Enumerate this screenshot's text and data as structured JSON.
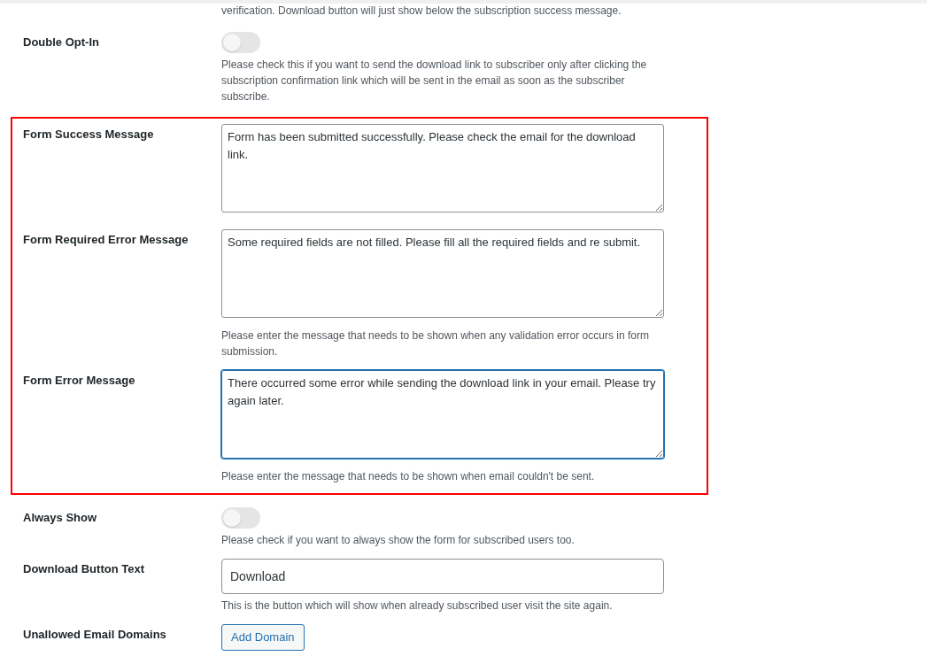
{
  "top_note": "verification. Download button will just show below the subscription success message.",
  "sections": [
    {
      "highlighted": false,
      "rows": [
        {
          "kind": "toggle",
          "label": "Double Opt-In",
          "on": false,
          "description": "Please check this if you want to send the download link to subscriber only after clicking the subscription confirmation link which will be sent in the email as soon as the subscriber subscribe."
        }
      ]
    },
    {
      "highlighted": true,
      "rows": [
        {
          "kind": "textarea",
          "label": "Form Success Message",
          "value": "Form has been submitted successfully. Please check the email for the download link.",
          "focused": false
        },
        {
          "kind": "textarea",
          "label": "Form Required Error Message",
          "value": "Some required fields are not filled. Please fill all the required fields and re submit.",
          "focused": false,
          "description": "Please enter the message that needs to be shown when any validation error occurs in form submission."
        },
        {
          "kind": "textarea",
          "label": "Form Error Message",
          "value": "There occurred some error while sending the download link in your email. Please try again later.",
          "focused": true,
          "description": "Please enter the message that needs to be shown when email couldn't be sent."
        }
      ]
    },
    {
      "highlighted": false,
      "rows": [
        {
          "kind": "toggle",
          "label": "Always Show",
          "on": false,
          "description": "Please check if you want to always show the form for subscribed users too."
        },
        {
          "kind": "input",
          "label": "Download Button Text",
          "value": "Download",
          "description": "This is the button which will show when already subscribed user visit the site again."
        },
        {
          "kind": "button",
          "label": "Unallowed Email Domains",
          "button": "Add Domain"
        }
      ]
    }
  ]
}
